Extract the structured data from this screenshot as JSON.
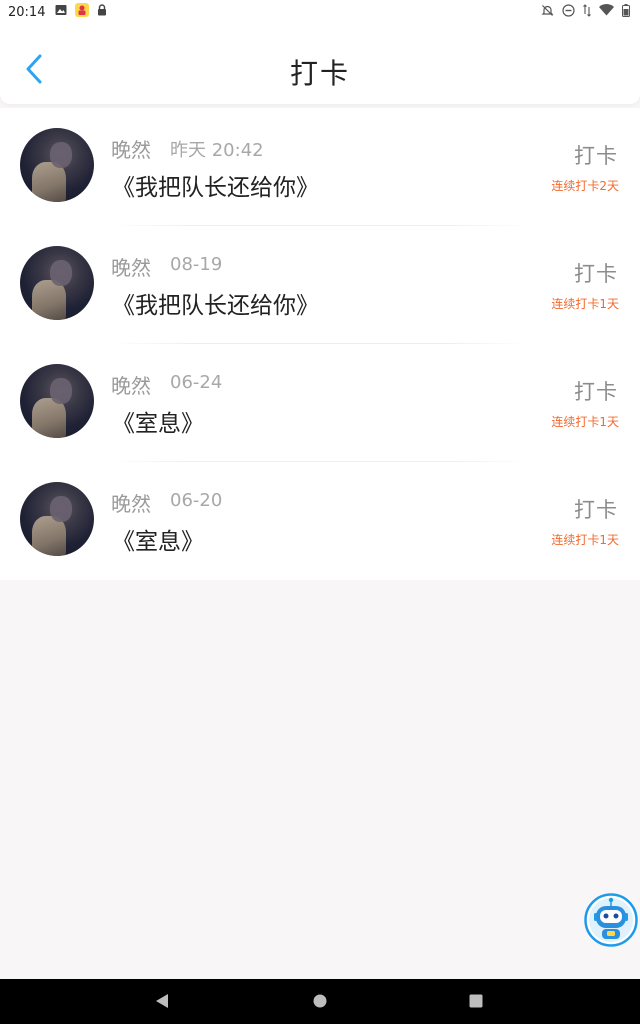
{
  "status_bar": {
    "time": "20:14"
  },
  "header": {
    "title": "打卡"
  },
  "records": [
    {
      "name": "晚然",
      "time": "昨天 20:42",
      "book": "《我把队长还给你》",
      "action": "打卡",
      "streak": "连续打卡2天"
    },
    {
      "name": "晚然",
      "time": "08-19",
      "book": "《我把队长还给你》",
      "action": "打卡",
      "streak": "连续打卡1天"
    },
    {
      "name": "晚然",
      "time": "06-24",
      "book": "《室息》",
      "action": "打卡",
      "streak": "连续打卡1天"
    },
    {
      "name": "晚然",
      "time": "06-20",
      "book": "《室息》",
      "action": "打卡",
      "streak": "连续打卡1天"
    }
  ],
  "colors": {
    "accent_blue": "#2aa4f4",
    "streak_orange": "#f26a2e",
    "background": "#f8f6f7"
  },
  "icons": {
    "back": "chevron-left-icon",
    "assistant": "robot-icon"
  }
}
